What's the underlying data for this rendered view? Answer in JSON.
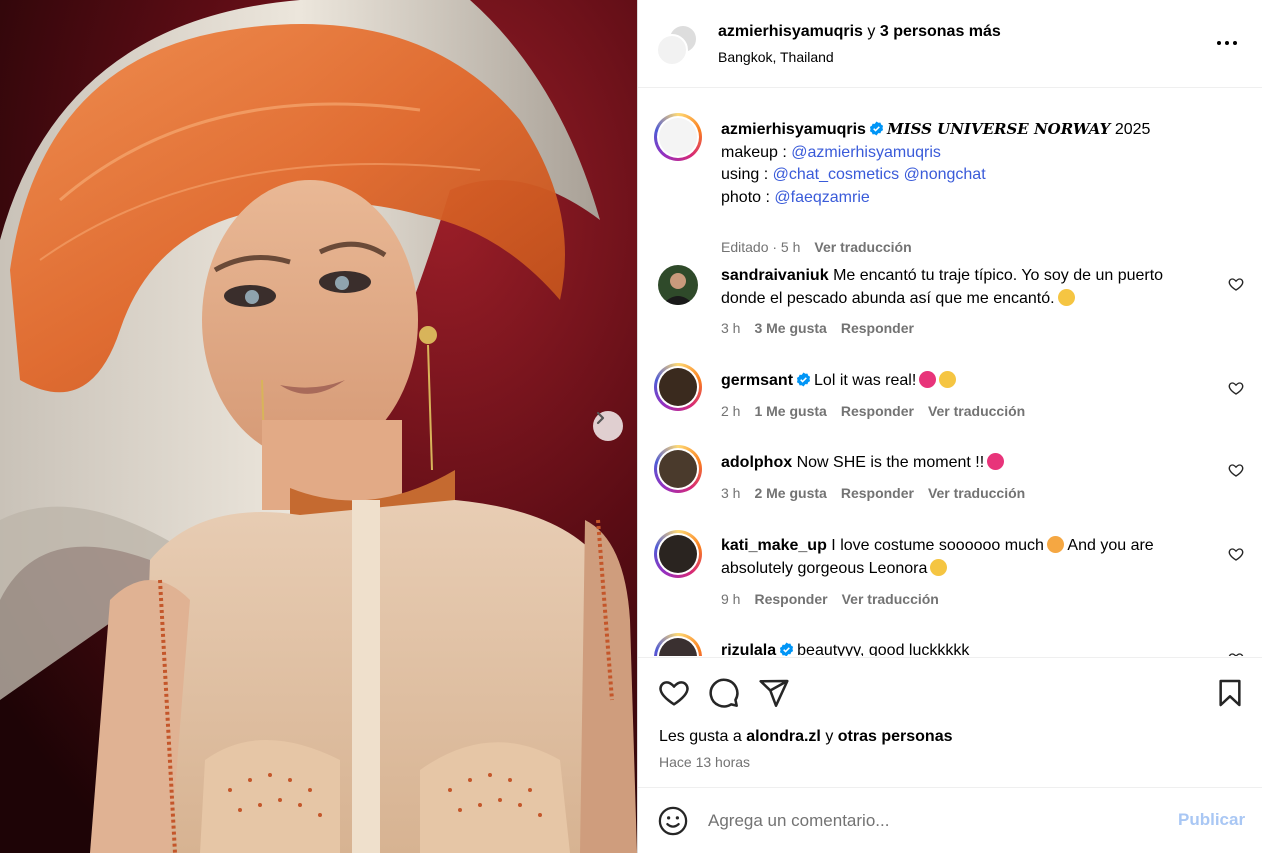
{
  "header": {
    "primary_user": "azmierhisyamuqris",
    "connector": "y",
    "others": "3 personas más",
    "location": "Bangkok, Thailand"
  },
  "caption": {
    "username": "azmierhisyamuqris",
    "title": "MISS UNIVERSE NORWAY",
    "title_year": "2025",
    "line2_label": "makeup :",
    "line2_link": "@azmierhisyamuqris",
    "line3_label": "using :",
    "line3_link1": "@chat_cosmetics",
    "line3_link2": "@nongchat",
    "line4_label": "photo :",
    "line4_link": "@faeqzamrie",
    "edited": "Editado · 5 h",
    "translate": "Ver traducción"
  },
  "comments": [
    {
      "username": "sandraivaniuk",
      "text": "Me encantó tu traje típico. Yo soy de un puerto donde el pescado abunda así que me encantó.",
      "time": "3 h",
      "likes": "3 Me gusta",
      "reply": "Responder",
      "translate": ""
    },
    {
      "username": "germsant",
      "text": "Lol it was real!",
      "time": "2 h",
      "likes": "1 Me gusta",
      "reply": "Responder",
      "translate": "Ver traducción"
    },
    {
      "username": "adolphox",
      "text": "Now SHE is the moment !!",
      "time": "3 h",
      "likes": "2 Me gusta",
      "reply": "Responder",
      "translate": "Ver traducción"
    },
    {
      "username": "kati_make_up",
      "text": "I love costume soooooo much",
      "text2": "And you are absolutely gorgeous Leonora",
      "time": "9 h",
      "likes": "",
      "reply": "Responder",
      "translate": "Ver traducción"
    },
    {
      "username": "rizulala",
      "text": "beautyyy, good luckkkkk"
    }
  ],
  "likes_line": {
    "prefix": "Les gusta a",
    "user": "alondra.zl",
    "connector": "y",
    "others": "otras personas"
  },
  "time_ago": "Hace 13 horas",
  "comment_box": {
    "placeholder": "Agrega un comentario...",
    "publish": "Publicar"
  },
  "colors": {
    "link": "#3a5bd9",
    "verified": "#0095f6",
    "muted": "#737373",
    "publish_disabled": "#a9c7f4"
  },
  "icons": [
    "more-icon",
    "verified-icon",
    "heart-icon",
    "comment-icon",
    "share-icon",
    "save-icon",
    "emoji-icon",
    "chevron-right-icon"
  ]
}
